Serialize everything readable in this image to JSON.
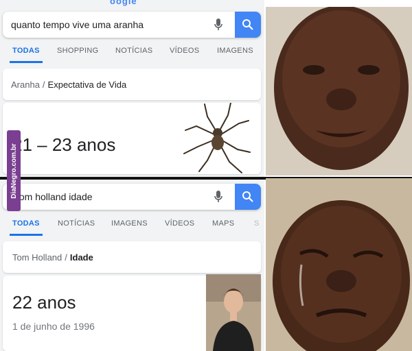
{
  "top": {
    "logo_fragment": "oogle",
    "query": "quanto tempo vive uma aranha",
    "tabs": [
      "TODAS",
      "SHOPPING",
      "NOTÍCIAS",
      "VÍDEOS",
      "IMAGENS"
    ],
    "breadcrumb_parent": "Aranha",
    "breadcrumb_sep": "/",
    "breadcrumb_topic": "Expectativa de Vida",
    "answer": "21 – 23 anos"
  },
  "bottom": {
    "query": "tom holland idade",
    "tabs": [
      "TODAS",
      "NOTÍCIAS",
      "IMAGENS",
      "VÍDEOS",
      "MAPS",
      "S"
    ],
    "breadcrumb_parent": "Tom Holland",
    "breadcrumb_sep": "/",
    "breadcrumb_topic": "Idade",
    "answer": "22 anos",
    "birthdate": "1 de junho de 1996"
  },
  "watermark": "DiaNegro.com.br",
  "colors": {
    "google_blue": "#4285f4",
    "tab_active": "#1a73e8",
    "watermark": "#7a3f91"
  },
  "icons": [
    "microphone-icon",
    "search-icon",
    "spider-image",
    "person-photo"
  ]
}
